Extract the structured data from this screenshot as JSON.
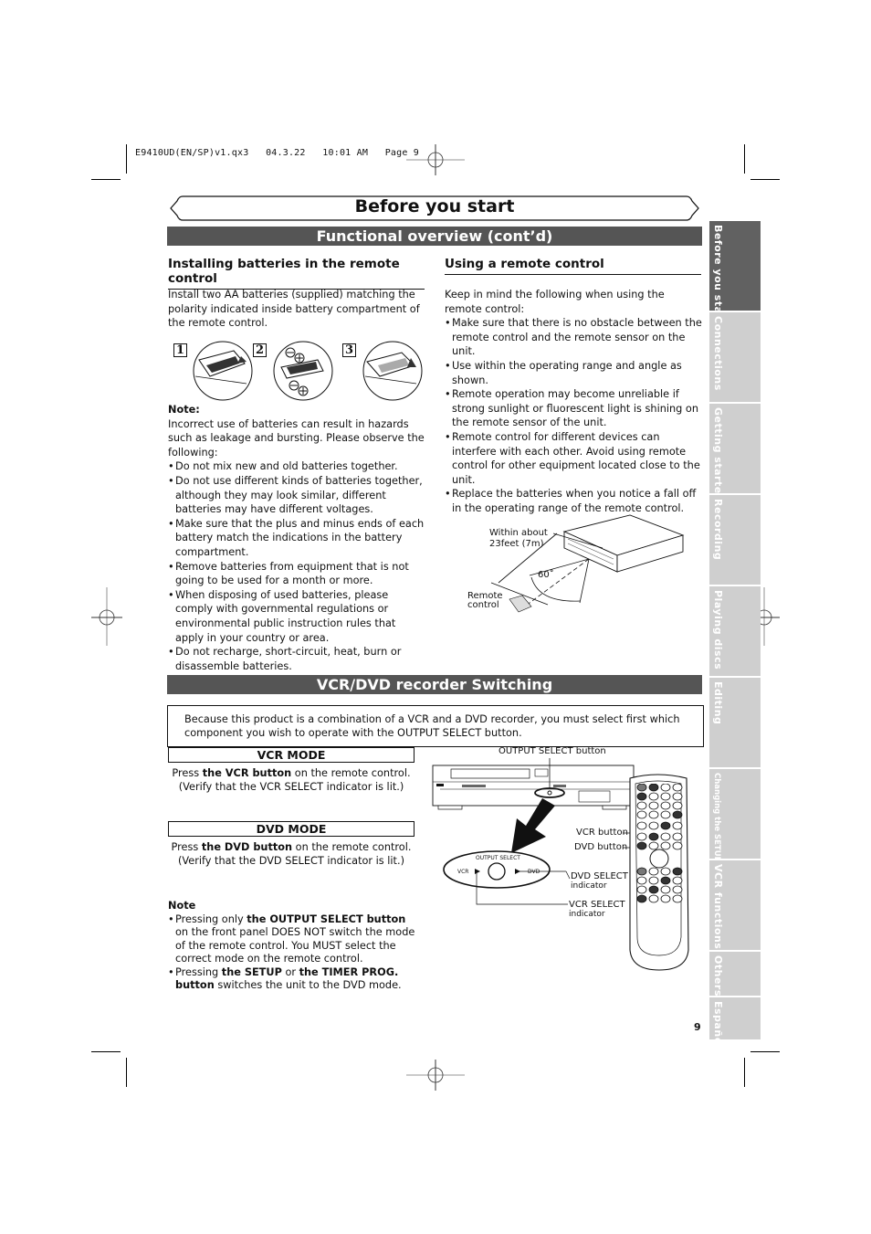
{
  "print_slug": "E9410UD(EN/SP)v1.qx3   04.3.22   10:01 AM   Page 9",
  "page_title": "Before you start",
  "section1": {
    "title": "Functional overview (cont’d)",
    "left": {
      "heading": "Installing batteries in the remote control",
      "intro": "Install two AA batteries (supplied) matching the polarity indicated inside battery compartment of the remote control.",
      "steps": [
        "1",
        "2",
        "3"
      ],
      "note_heading": "Note:",
      "note_intro": "Incorrect use of batteries can result in hazards such as leakage and bursting. Please observe the following:",
      "bullets": [
        "Do not mix new and old batteries together.",
        "Do not use different kinds of batteries together, although they may look similar, different batteries may have different voltages.",
        "Make sure that the plus and minus ends of each battery match the indications in the battery compartment.",
        "Remove batteries from equipment that is not going to be used for a month or more.",
        "When disposing of used batteries, please comply with governmental regulations or environmental public instruction rules that apply in your country or area.",
        "Do not recharge, short-circuit, heat, burn or disassemble batteries."
      ]
    },
    "right": {
      "heading": "Using a remote control",
      "intro": "Keep in mind the following when using the remote control:",
      "bullets": [
        "Make sure that there is no obstacle between the remote control and the remote sensor on the unit.",
        "Use within the operating range and angle as shown.",
        "Remote operation may become unreliable if strong sunlight or fluorescent light is shining on the remote sensor of the unit.",
        "Remote control for different devices can interfere with each other.  Avoid using remote control for other equipment located close to the unit.",
        "Replace the batteries when you notice a fall off in the operating range of the remote control."
      ],
      "diagram": {
        "range_label_1": "Within about",
        "range_label_2": "23feet (7m)",
        "angle_label": "60˚",
        "remote_label_1": "Remote",
        "remote_label_2": "control"
      }
    }
  },
  "section2": {
    "title": "VCR/DVD recorder Switching",
    "intro": "Because this product is a combination of a VCR and a DVD recorder, you must select first which component you wish to operate with the OUTPUT SELECT button.",
    "vcr_mode": {
      "title": "VCR MODE",
      "pre": "Press ",
      "bold": "the VCR button",
      "post": " on the remote control.",
      "line2": "(Verify that the VCR SELECT indicator is lit.)"
    },
    "dvd_mode": {
      "title": "DVD MODE",
      "pre": "Press ",
      "bold": "the DVD button",
      "post": " on the remote control.",
      "line2": "(Verify that the DVD SELECT indicator is lit.)"
    },
    "note": {
      "heading": "Note",
      "b1_pre": "Pressing only ",
      "b1_bold": "the OUTPUT SELECT button",
      "b1_post": " on the front panel DOES NOT switch the mode of the remote control. You MUST select the correct mode on the remote control.",
      "b2_pre": "Pressing ",
      "b2_bold1": "the SETUP",
      "b2_mid": " or ",
      "b2_bold2": "the TIMER PROG. button",
      "b2_post": " switches the unit to the DVD mode."
    },
    "diagram": {
      "output_select_button": "OUTPUT SELECT button",
      "panel_label": "OUTPUT SELECT",
      "vcr": "VCR",
      "dvd": "DVD",
      "vcr_button": "VCR button",
      "dvd_button": "DVD button",
      "dvd_select_1": "DVD SELECT",
      "dvd_select_2": "indicator",
      "vcr_select_1": "VCR SELECT",
      "vcr_select_2": "indicator"
    }
  },
  "side_tabs": [
    {
      "label": "Before you start",
      "active": true
    },
    {
      "label": "Connections",
      "active": false
    },
    {
      "label": "Getting started",
      "active": false
    },
    {
      "label": "Recording",
      "active": false
    },
    {
      "label": "Playing discs",
      "active": false
    },
    {
      "label": "Editing",
      "active": false
    },
    {
      "label": "Changing the SETUP menu",
      "active": false
    },
    {
      "label": "VCR functions",
      "active": false
    },
    {
      "label": "Others",
      "active": false
    },
    {
      "label": "Español",
      "active": false
    }
  ],
  "page_number": "9"
}
